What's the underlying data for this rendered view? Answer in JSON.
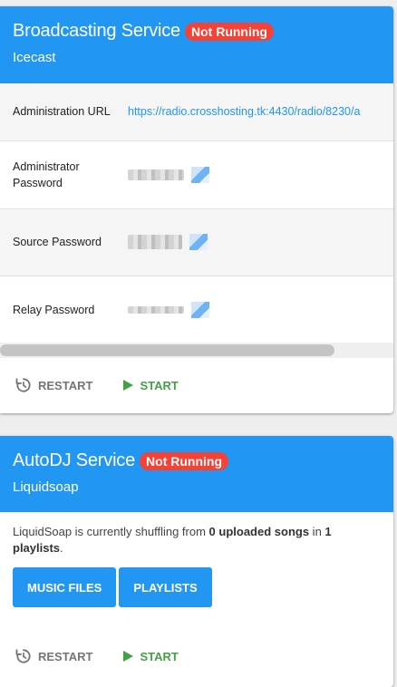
{
  "broadcast": {
    "title": "Broadcasting Service",
    "status": "Not Running",
    "subtitle": "Icecast",
    "rows": [
      {
        "label": "Administration URL",
        "value": "https://radio.crosshosting.tk:4430/radio/8230/a"
      },
      {
        "label": "Administrator Password",
        "value": ""
      },
      {
        "label": "Source Password",
        "value": ""
      },
      {
        "label": "Relay Password",
        "value": ""
      }
    ],
    "restart_label": "RESTART",
    "start_label": "START"
  },
  "autodj": {
    "title": "AutoDJ Service",
    "status": "Not Running",
    "subtitle": "Liquidsoap",
    "description": {
      "before": "LiquidSoap is currently shuffling from ",
      "songs": "0 uploaded songs",
      "middle": " in ",
      "playlists_count": "1",
      "playlists_word": "playlists",
      "after": "."
    },
    "music_files_label": "MUSIC FILES",
    "playlists_label": "PLAYLISTS",
    "restart_label": "RESTART",
    "start_label": "START"
  },
  "colors": {
    "header": "#2196f3",
    "badge": "#f44336",
    "start": "#43a047",
    "restart": "#757575"
  },
  "icons": {
    "restart": "restart-clock-icon",
    "start": "play-triangle-icon"
  }
}
